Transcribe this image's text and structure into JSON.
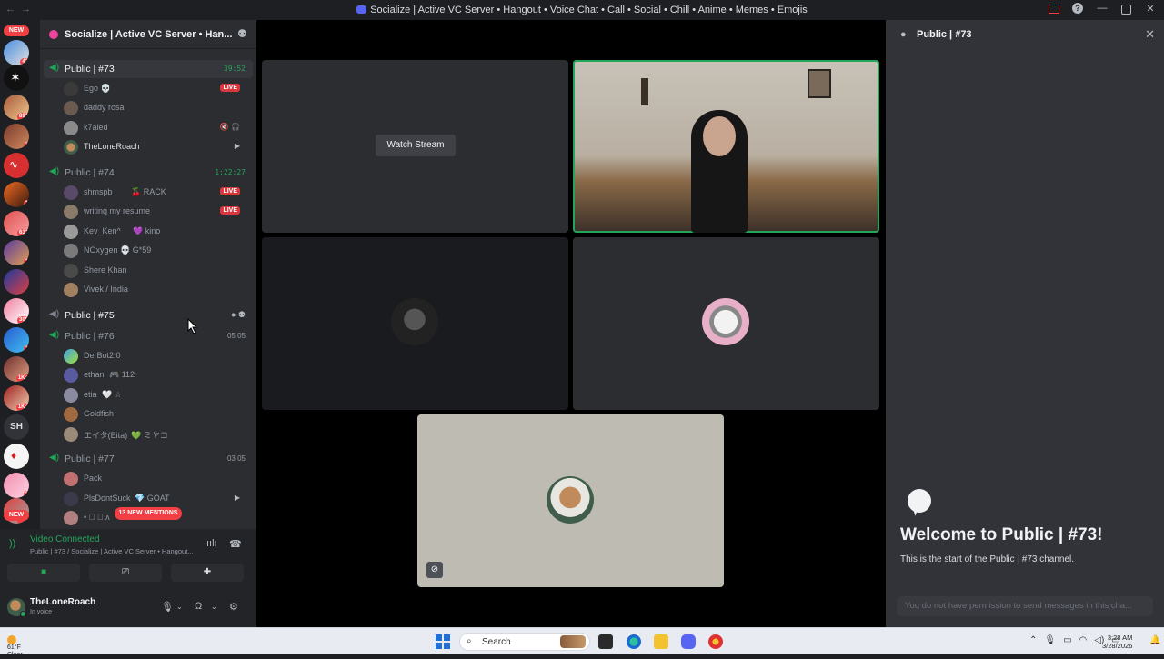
{
  "window": {
    "title": "Socialize | Active VC Server • Hangout • Voice Chat • Call • Social • Chill • Anime • Memes • Emojis"
  },
  "rail": {
    "new_label": "NEW",
    "servers": [
      {
        "badge": "42"
      },
      {
        "badge": ""
      },
      {
        "badge": "891"
      },
      {
        "badge": "7"
      },
      {
        "badge": ""
      },
      {
        "badge": "1"
      },
      {
        "badge": "631"
      },
      {
        "badge": "1"
      },
      {
        "badge": ""
      },
      {
        "badge": "309"
      },
      {
        "badge": "1"
      },
      {
        "badge": "1K+"
      },
      {
        "badge": "1K+"
      }
    ],
    "text_server": "SH",
    "bottom_badges": [
      "3",
      "346"
    ]
  },
  "sidebar": {
    "server_name": "Socialize | Active VC Server • Han...",
    "channels": [
      {
        "name": "Public | #73",
        "time": "39:52"
      },
      {
        "name": "Public | #74",
        "time": "1:22:27"
      },
      {
        "name": "Public | #75"
      },
      {
        "name": "Public | #76",
        "count": "05  05"
      },
      {
        "name": "Public | #77",
        "count": "03  05"
      }
    ],
    "users73": [
      {
        "name": "Ego 💀",
        "live": "LIVE"
      },
      {
        "name": "daddy rosa"
      },
      {
        "name": "k7aled",
        "icons": "🔇 🎧"
      },
      {
        "name": "TheLoneRoach",
        "icons": "▶"
      }
    ],
    "users74": [
      {
        "name": "shmspb",
        "tag": "🍒 RACK",
        "live": "LIVE"
      },
      {
        "name": "writing my resume",
        "live": "LIVE"
      },
      {
        "name": "Kev_Ken^",
        "tag": "💜 kino"
      },
      {
        "name": "NOxygen",
        "tag": "💀 G*59"
      },
      {
        "name": "Shere Khan"
      },
      {
        "name": "Vivek / India"
      }
    ],
    "users76": [
      {
        "name": "DerBot2.0"
      },
      {
        "name": "ethan",
        "tag": "🎮 112"
      },
      {
        "name": "etia",
        "tag": "🤍 ☆"
      },
      {
        "name": "Goldfish"
      },
      {
        "name": "エイタ(Eita)",
        "tag": "💚 ミヤコ"
      }
    ],
    "users77": [
      {
        "name": "Pack"
      },
      {
        "name": "PlsDontSuck",
        "tag": "💎 GOAT",
        "icons": "▶"
      },
      {
        "name": "• ゙ ゙ ʌ"
      }
    ],
    "mentions": "13 NEW MENTIONS"
  },
  "voice": {
    "status": "Video Connected",
    "location": "Public | #73 / Socialize | Active VC Server • Hangout..."
  },
  "user": {
    "name": "TheLoneRoach",
    "status": "In voice"
  },
  "stage": {
    "watch_stream": "Watch Stream"
  },
  "chat": {
    "channel": "Public | #73",
    "welcome": "Welcome to Public | #73!",
    "welcome_sub": "This is the start of the Public | #73 channel.",
    "no_permission": "You do not have permission to send messages in this cha..."
  },
  "taskbar": {
    "temp": "61°F",
    "condition": "Clear",
    "search": "Search",
    "time": "3:28 AM",
    "date": "3/28/2026"
  },
  "colors": {
    "accent_green": "#23a55a",
    "live_red": "#da373c",
    "brand": "#5865f2"
  }
}
